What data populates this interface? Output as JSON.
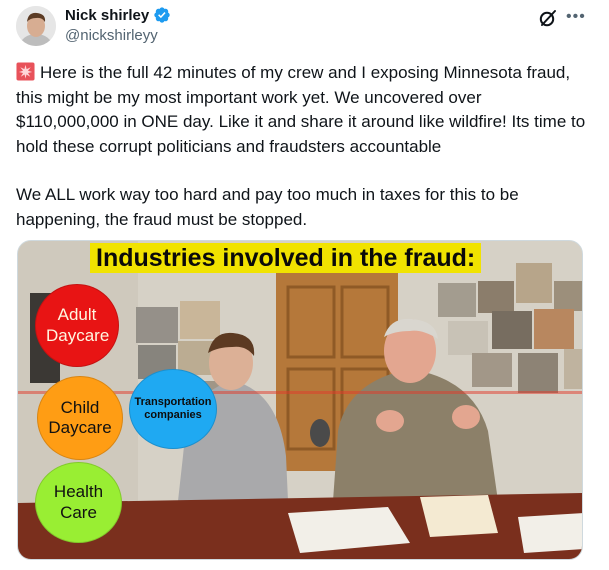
{
  "author": {
    "display_name": "Nick shirley",
    "handle": "@nickshirleyy",
    "verified": true,
    "avatar_icon": "profile-photo"
  },
  "header_icons": [
    "grok-icon",
    "more-options-icon"
  ],
  "tweet": {
    "paragraph1": "Here is the full 42 minutes of my crew and I exposing Minnesota fraud, this might be my most important work yet. We uncovered over $110,000,000 in ONE day. Like it and share it around like wildfire! Its time to hold these corrupt politicians and fraudsters accountable",
    "paragraph2": "We ALL work way too hard and pay too much in taxes for this to be happening, the fraud must be stopped.",
    "leading_emoji": "rotating-light-emoji"
  },
  "media": {
    "title": "Industries involved in the fraud:",
    "circles": [
      {
        "label": "Adult Daycare",
        "color": "#e81414"
      },
      {
        "label": "Child Daycare",
        "color": "#ff9d14"
      },
      {
        "label": "Transportation companies",
        "color": "#1fa9f2"
      },
      {
        "label": "Health Care",
        "color": "#99ee33"
      }
    ]
  },
  "colors": {
    "verified_badge": "#1d9bf0",
    "title_highlight": "#f1e300",
    "text_secondary": "#536471"
  }
}
